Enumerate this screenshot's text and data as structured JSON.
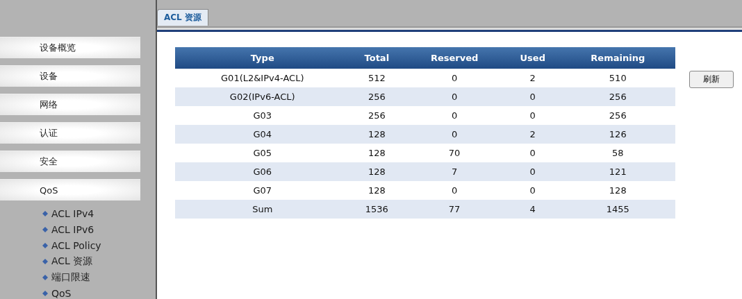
{
  "sidebar": {
    "items": [
      {
        "label": "设备概览"
      },
      {
        "label": "设备"
      },
      {
        "label": "网络"
      },
      {
        "label": "认证"
      },
      {
        "label": "安全"
      },
      {
        "label": "QoS",
        "children": [
          {
            "label": "ACL IPv4"
          },
          {
            "label": "ACL IPv6"
          },
          {
            "label": "ACL Policy"
          },
          {
            "label": "ACL 资源"
          },
          {
            "label": "端口限速"
          },
          {
            "label": "QoS"
          }
        ]
      }
    ]
  },
  "tabs": [
    {
      "label": "ACL 资源",
      "selected": true
    }
  ],
  "table": {
    "columns": [
      "Type",
      "Total",
      "Reserved",
      "Used",
      "Remaining"
    ],
    "rows": [
      [
        "G01(L2&IPv4-ACL)",
        "512",
        "0",
        "2",
        "510"
      ],
      [
        "G02(IPv6-ACL)",
        "256",
        "0",
        "0",
        "256"
      ],
      [
        "G03",
        "256",
        "0",
        "0",
        "256"
      ],
      [
        "G04",
        "128",
        "0",
        "2",
        "126"
      ],
      [
        "G05",
        "128",
        "70",
        "0",
        "58"
      ],
      [
        "G06",
        "128",
        "7",
        "0",
        "121"
      ],
      [
        "G07",
        "128",
        "0",
        "0",
        "128"
      ],
      [
        "Sum",
        "1536",
        "77",
        "4",
        "1455"
      ]
    ]
  },
  "refresh_button": "刷新"
}
